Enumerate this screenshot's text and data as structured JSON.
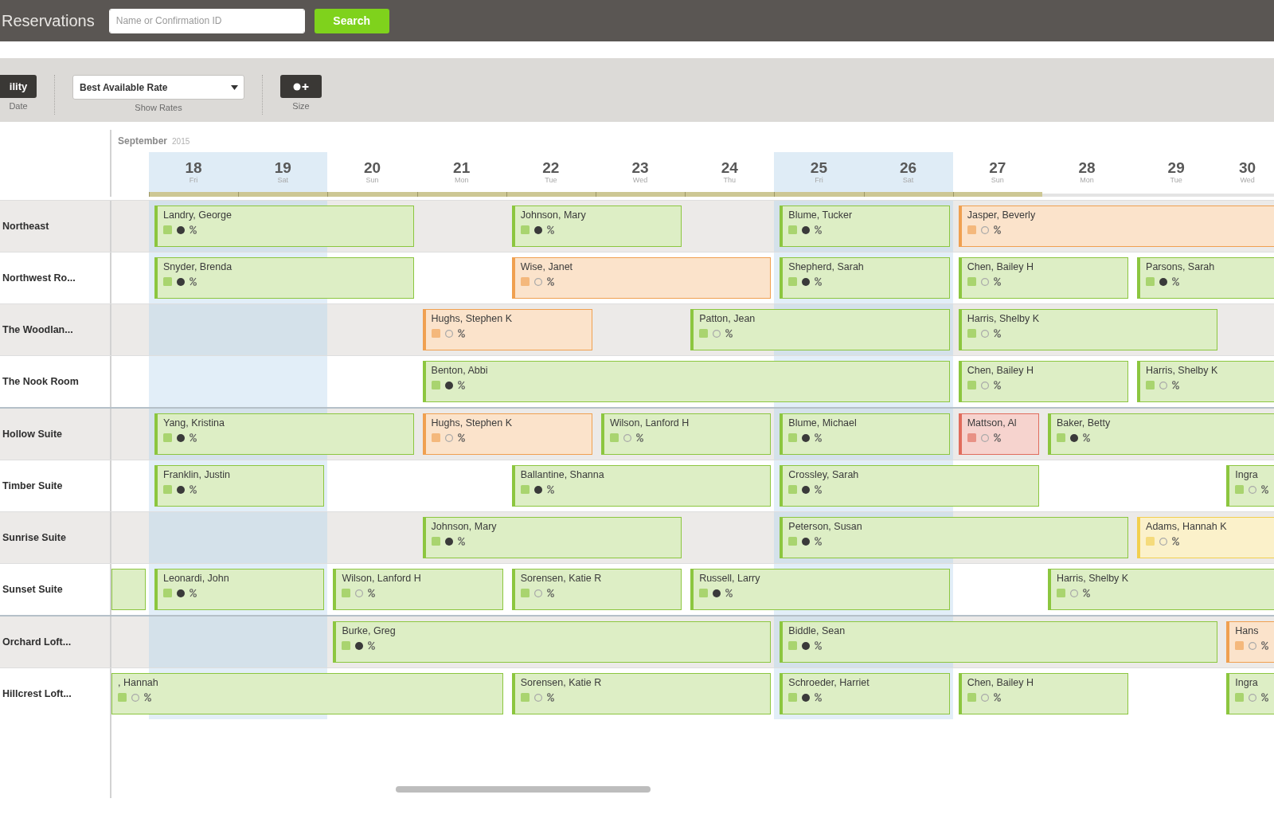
{
  "header": {
    "title": "Reservations",
    "search": {
      "placeholder": "Name or Confirmation ID"
    },
    "search_button": "Search"
  },
  "toolbar": {
    "items": [
      {
        "kind": "button",
        "label": "ility",
        "caption": "Date"
      },
      {
        "kind": "select",
        "value": "Best Available Rate",
        "caption": "Show Rates"
      },
      {
        "kind": "icon_button",
        "caption": "Size"
      }
    ]
  },
  "calendar": {
    "month": "September",
    "year": "2015",
    "days": [
      {
        "day": "18",
        "weekday": "Fri",
        "highlighted": true,
        "flagged": true
      },
      {
        "day": "19",
        "weekday": "Sat",
        "highlighted": true,
        "flagged": true
      },
      {
        "day": "20",
        "weekday": "Sun",
        "highlighted": false,
        "flagged": true
      },
      {
        "day": "21",
        "weekday": "Mon",
        "highlighted": false,
        "flagged": true
      },
      {
        "day": "22",
        "weekday": "Tue",
        "highlighted": false,
        "flagged": true
      },
      {
        "day": "23",
        "weekday": "Wed",
        "highlighted": false,
        "flagged": true
      },
      {
        "day": "24",
        "weekday": "Thu",
        "highlighted": false,
        "flagged": true
      },
      {
        "day": "25",
        "weekday": "Fri",
        "highlighted": true,
        "flagged": true
      },
      {
        "day": "26",
        "weekday": "Sat",
        "highlighted": true,
        "flagged": true
      },
      {
        "day": "27",
        "weekday": "Sun",
        "highlighted": false,
        "flagged": true
      },
      {
        "day": "28",
        "weekday": "Mon",
        "highlighted": false,
        "flagged": false
      },
      {
        "day": "29",
        "weekday": "Tue",
        "highlighted": false,
        "flagged": false
      },
      {
        "day": "30",
        "weekday": "Wed",
        "highlighted": false,
        "flagged": false
      }
    ],
    "room_groups": [
      {
        "rooms": [
          {
            "name": "Northeast",
            "timeline": [
              {
                "kind": "empty"
              },
              {
                "kind": "booking",
                "guest": "Landry, George",
                "color": "#8cc63f",
                "marker_filled": true,
                "continues_before": false,
                "continues_after": false
              },
              {
                "kind": "night"
              },
              {
                "kind": "night"
              },
              {
                "kind": "empty"
              },
              {
                "kind": "booking",
                "guest": "Johnson, Mary",
                "color": "#8cc63f",
                "marker_filled": true,
                "continues_before": false,
                "continues_after": false
              },
              {
                "kind": "night"
              },
              {
                "kind": "empty"
              },
              {
                "kind": "booking",
                "guest": "Blume, Tucker",
                "color": "#8cc63f",
                "marker_filled": true,
                "continues_before": false,
                "continues_after": false
              },
              {
                "kind": "night"
              },
              {
                "kind": "booking",
                "guest": "Jasper, Beverly",
                "color": "#f0a050",
                "marker_filled": false,
                "continues_before": false,
                "continues_after": true
              },
              {
                "kind": "night"
              },
              {
                "kind": "night"
              },
              {
                "kind": "night"
              }
            ]
          },
          {
            "name": "Northwest Ro...",
            "timeline": [
              {
                "kind": "empty"
              },
              {
                "kind": "booking",
                "guest": "Snyder, Brenda",
                "color": "#8cc63f",
                "marker_filled": true,
                "continues_before": false,
                "continues_after": false
              },
              {
                "kind": "night"
              },
              {
                "kind": "night"
              },
              {
                "kind": "empty"
              },
              {
                "kind": "booking",
                "guest": "Wise, Janet",
                "color": "#f0a050",
                "marker_filled": false,
                "continues_before": false,
                "continues_after": false
              },
              {
                "kind": "night"
              },
              {
                "kind": "night"
              },
              {
                "kind": "booking",
                "guest": "Shepherd, Sarah",
                "color": "#8cc63f",
                "marker_filled": true,
                "continues_before": false,
                "continues_after": false
              },
              {
                "kind": "night"
              },
              {
                "kind": "booking",
                "guest": "Chen, Bailey H",
                "color": "#8cc63f",
                "marker_filled": false,
                "continues_before": false,
                "continues_after": false
              },
              {
                "kind": "night"
              },
              {
                "kind": "booking",
                "guest": "Parsons, Sarah",
                "color": "#8cc63f",
                "marker_filled": true,
                "continues_before": false,
                "continues_after": true
              },
              {
                "kind": "night"
              }
            ]
          },
          {
            "name": "The Woodlan...",
            "timeline": [
              {
                "kind": "empty"
              },
              {
                "kind": "empty"
              },
              {
                "kind": "empty"
              },
              {
                "kind": "empty"
              },
              {
                "kind": "booking",
                "guest": "Hughs, Stephen K",
                "color": "#f0a050",
                "marker_filled": false,
                "continues_before": false,
                "continues_after": false
              },
              {
                "kind": "night"
              },
              {
                "kind": "empty"
              },
              {
                "kind": "booking",
                "guest": "Patton, Jean",
                "color": "#8cc63f",
                "marker_filled": false,
                "continues_before": false,
                "continues_after": false
              },
              {
                "kind": "night"
              },
              {
                "kind": "night"
              },
              {
                "kind": "booking",
                "guest": "Harris, Shelby K",
                "color": "#8cc63f",
                "marker_filled": false,
                "continues_before": false,
                "continues_after": false
              },
              {
                "kind": "night"
              },
              {
                "kind": "night"
              },
              {
                "kind": "empty"
              }
            ]
          },
          {
            "name": "The Nook Room",
            "timeline": [
              {
                "kind": "empty"
              },
              {
                "kind": "empty"
              },
              {
                "kind": "empty"
              },
              {
                "kind": "empty"
              },
              {
                "kind": "booking",
                "guest": "Benton, Abbi",
                "color": "#8cc63f",
                "marker_filled": true,
                "continues_before": false,
                "continues_after": false
              },
              {
                "kind": "night"
              },
              {
                "kind": "night"
              },
              {
                "kind": "night"
              },
              {
                "kind": "night"
              },
              {
                "kind": "night"
              },
              {
                "kind": "booking",
                "guest": "Chen, Bailey H",
                "color": "#8cc63f",
                "marker_filled": false,
                "continues_before": false,
                "continues_after": false
              },
              {
                "kind": "night"
              },
              {
                "kind": "booking",
                "guest": "Harris, Shelby K",
                "color": "#8cc63f",
                "marker_filled": false,
                "continues_before": false,
                "continues_after": true
              },
              {
                "kind": "night"
              }
            ]
          }
        ]
      },
      {
        "rooms": [
          {
            "name": "Hollow Suite",
            "timeline": [
              {
                "kind": "empty"
              },
              {
                "kind": "booking",
                "guest": "Yang, Kristina",
                "color": "#8cc63f",
                "marker_filled": true,
                "continues_before": false,
                "continues_after": false
              },
              {
                "kind": "night"
              },
              {
                "kind": "night"
              },
              {
                "kind": "booking",
                "guest": "Hughs, Stephen K",
                "color": "#f0a050",
                "marker_filled": false,
                "continues_before": false,
                "continues_after": false
              },
              {
                "kind": "night"
              },
              {
                "kind": "booking",
                "guest": "Wilson, Lanford H",
                "color": "#8cc63f",
                "marker_filled": false,
                "continues_before": false,
                "continues_after": false
              },
              {
                "kind": "night"
              },
              {
                "kind": "booking",
                "guest": "Blume, Michael",
                "color": "#8cc63f",
                "marker_filled": true,
                "continues_before": false,
                "continues_after": false
              },
              {
                "kind": "night"
              },
              {
                "kind": "booking",
                "guest": "Mattson, Al",
                "color": "#e06c5c",
                "marker_filled": false,
                "continues_before": false,
                "continues_after": false
              },
              {
                "kind": "booking",
                "guest": "Baker, Betty",
                "color": "#8cc63f",
                "marker_filled": true,
                "continues_before": false,
                "continues_after": true
              },
              {
                "kind": "night"
              },
              {
                "kind": "night"
              }
            ]
          },
          {
            "name": "Timber Suite",
            "timeline": [
              {
                "kind": "empty"
              },
              {
                "kind": "booking",
                "guest": "Franklin, Justin",
                "color": "#8cc63f",
                "marker_filled": true,
                "continues_before": false,
                "continues_after": false
              },
              {
                "kind": "night"
              },
              {
                "kind": "empty"
              },
              {
                "kind": "empty"
              },
              {
                "kind": "booking",
                "guest": "Ballantine, Shanna",
                "color": "#8cc63f",
                "marker_filled": true,
                "continues_before": false,
                "continues_after": false
              },
              {
                "kind": "night"
              },
              {
                "kind": "night"
              },
              {
                "kind": "booking",
                "guest": "Crossley, Sarah",
                "color": "#8cc63f",
                "marker_filled": true,
                "continues_before": false,
                "continues_after": false
              },
              {
                "kind": "night"
              },
              {
                "kind": "night"
              },
              {
                "kind": "empty"
              },
              {
                "kind": "empty"
              },
              {
                "kind": "booking",
                "guest": "Ingra",
                "color": "#8cc63f",
                "marker_filled": false,
                "continues_before": false,
                "continues_after": true
              }
            ]
          },
          {
            "name": "Sunrise Suite",
            "timeline": [
              {
                "kind": "empty"
              },
              {
                "kind": "empty"
              },
              {
                "kind": "empty"
              },
              {
                "kind": "empty"
              },
              {
                "kind": "booking",
                "guest": "Johnson, Mary",
                "color": "#8cc63f",
                "marker_filled": true,
                "continues_before": false,
                "continues_after": false
              },
              {
                "kind": "night"
              },
              {
                "kind": "night"
              },
              {
                "kind": "empty"
              },
              {
                "kind": "booking",
                "guest": "Peterson, Susan",
                "color": "#8cc63f",
                "marker_filled": true,
                "continues_before": false,
                "continues_after": false
              },
              {
                "kind": "night"
              },
              {
                "kind": "night"
              },
              {
                "kind": "night"
              },
              {
                "kind": "booking",
                "guest": "Adams, Hannah K",
                "color": "#f2cf4f",
                "marker_filled": false,
                "continues_before": false,
                "continues_after": true
              },
              {
                "kind": "night"
              }
            ]
          },
          {
            "name": "Sunset Suite",
            "timeline": [
              {
                "kind": "booking",
                "color": "#8cc63f",
                "continues_before": true,
                "continues_after": false
              },
              {
                "kind": "booking",
                "guest": "Leonardi, John",
                "color": "#8cc63f",
                "marker_filled": true,
                "continues_before": false,
                "continues_after": false
              },
              {
                "kind": "night"
              },
              {
                "kind": "booking",
                "guest": "Wilson, Lanford H",
                "color": "#8cc63f",
                "marker_filled": false,
                "continues_before": false,
                "continues_after": false
              },
              {
                "kind": "night"
              },
              {
                "kind": "booking",
                "guest": "Sorensen, Katie R",
                "color": "#8cc63f",
                "marker_filled": false,
                "continues_before": false,
                "continues_after": false
              },
              {
                "kind": "night"
              },
              {
                "kind": "booking",
                "guest": "Russell, Larry",
                "color": "#8cc63f",
                "marker_filled": true,
                "continues_before": false,
                "continues_after": false
              },
              {
                "kind": "night"
              },
              {
                "kind": "night"
              },
              {
                "kind": "empty"
              },
              {
                "kind": "booking",
                "guest": "Harris, Shelby K",
                "color": "#8cc63f",
                "marker_filled": false,
                "continues_before": false,
                "continues_after": true
              },
              {
                "kind": "night"
              },
              {
                "kind": "night"
              }
            ]
          }
        ]
      },
      {
        "rooms": [
          {
            "name": "Orchard Loft...",
            "timeline": [
              {
                "kind": "empty"
              },
              {
                "kind": "empty"
              },
              {
                "kind": "empty"
              },
              {
                "kind": "booking",
                "guest": "Burke, Greg",
                "color": "#8cc63f",
                "marker_filled": true,
                "continues_before": false,
                "continues_after": false
              },
              {
                "kind": "night"
              },
              {
                "kind": "night"
              },
              {
                "kind": "night"
              },
              {
                "kind": "night"
              },
              {
                "kind": "booking",
                "guest": "Biddle, Sean",
                "color": "#8cc63f",
                "marker_filled": true,
                "continues_before": false,
                "continues_after": false
              },
              {
                "kind": "night"
              },
              {
                "kind": "night"
              },
              {
                "kind": "night"
              },
              {
                "kind": "night"
              },
              {
                "kind": "booking",
                "guest": "Hans",
                "color": "#f0a050",
                "marker_filled": false,
                "continues_before": false,
                "continues_after": true
              }
            ]
          },
          {
            "name": "Hillcrest Loft...",
            "timeline": [
              {
                "kind": "booking",
                "guest": ", Hannah",
                "color": "#8cc63f",
                "marker_filled": false,
                "continues_before": true,
                "continues_after": false
              },
              {
                "kind": "night"
              },
              {
                "kind": "night"
              },
              {
                "kind": "night"
              },
              {
                "kind": "night"
              },
              {
                "kind": "booking",
                "guest": "Sorensen, Katie R",
                "color": "#8cc63f",
                "marker_filled": false,
                "continues_before": false,
                "continues_after": false
              },
              {
                "kind": "night"
              },
              {
                "kind": "night"
              },
              {
                "kind": "booking",
                "guest": "Schroeder, Harriet",
                "color": "#8cc63f",
                "marker_filled": true,
                "continues_before": false,
                "continues_after": false
              },
              {
                "kind": "night"
              },
              {
                "kind": "booking",
                "guest": "Chen, Bailey H",
                "color": "#8cc63f",
                "marker_filled": false,
                "continues_before": false,
                "continues_after": false
              },
              {
                "kind": "night"
              },
              {
                "kind": "empty"
              },
              {
                "kind": "booking",
                "guest": "Ingra",
                "color": "#8cc63f",
                "marker_filled": false,
                "continues_before": false,
                "continues_after": true
              }
            ]
          }
        ]
      }
    ]
  }
}
